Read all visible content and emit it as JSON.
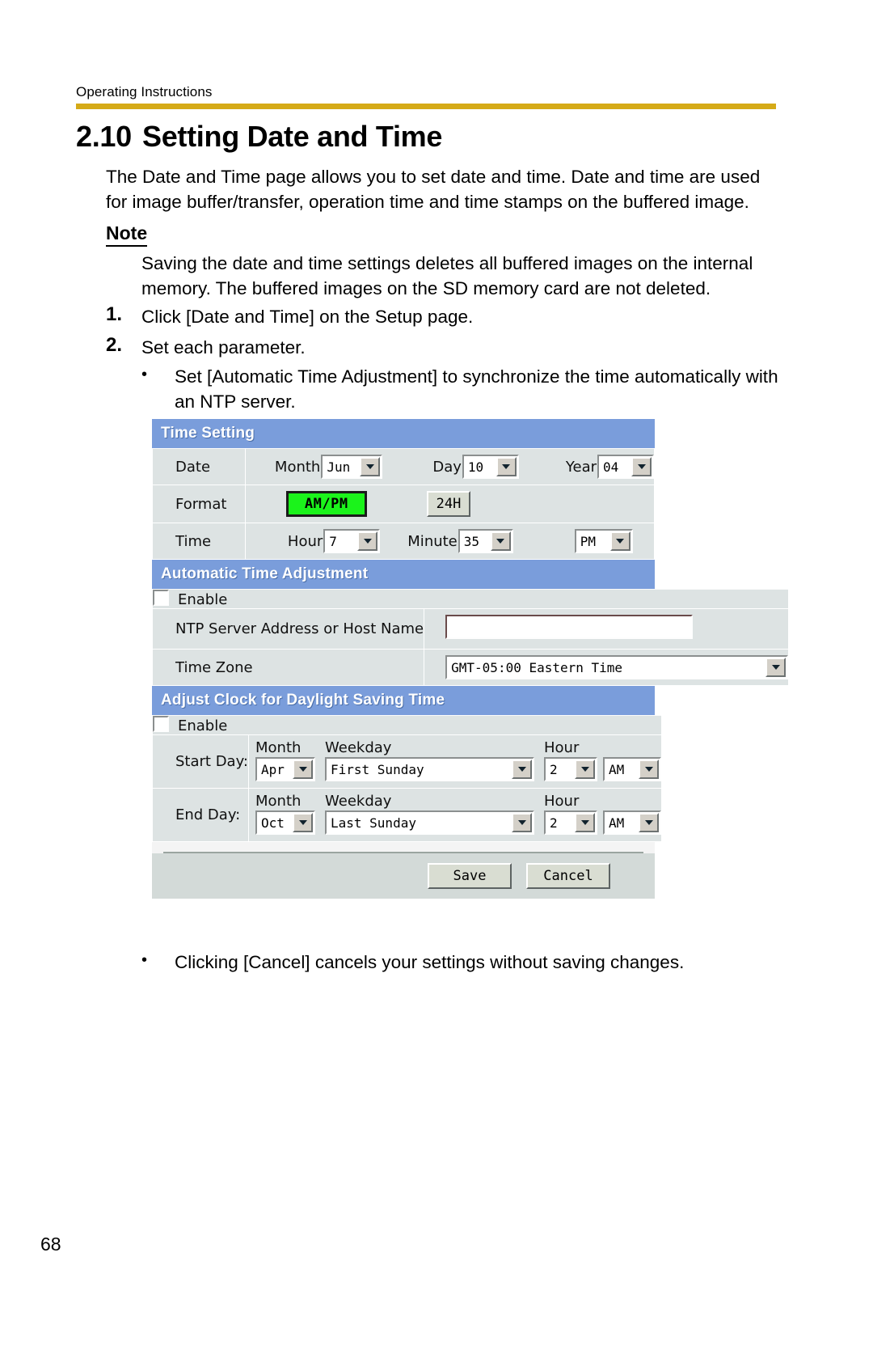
{
  "document": {
    "running_header": "Operating Instructions",
    "section_number": "2.10",
    "section_title": "Setting Date and Time",
    "intro": "The Date and Time page allows you to set date and time. Date and time are used for image buffer/transfer, operation time and time stamps on the buffered image.",
    "note_heading": "Note",
    "note_body": "Saving the date and time settings deletes all buffered images on the internal memory. The buffered images on the SD memory card are not deleted.",
    "steps": [
      {
        "number": "1.",
        "text": "Click [Date and Time] on the Setup page."
      },
      {
        "number": "2.",
        "text": "Set each parameter."
      }
    ],
    "bullets": [
      {
        "marker": "•",
        "text": "Set [Automatic Time Adjustment] to synchronize the time automatically with an NTP server."
      },
      {
        "marker": "•",
        "text": "Clicking [Cancel] cancels your settings without saving changes."
      }
    ],
    "page_number": "68",
    "rule_color": "#d5aa17"
  },
  "screenshot": {
    "band_color": "#7a9ddb",
    "time_setting": {
      "band_title": "Time Setting",
      "date": {
        "label": "Date",
        "month_label": "Month",
        "month_value": "Jun",
        "day_label": "Day",
        "day_value": "10",
        "year_label": "Year",
        "year_value": "04"
      },
      "format": {
        "label": "Format",
        "ampm_button": "AM/PM",
        "ampm_selected": true,
        "h24_button": "24H",
        "selected_color": "#1bf31b"
      },
      "time": {
        "label": "Time",
        "hour_label": "Hour",
        "hour_value": "7",
        "minute_label": "Minute",
        "minute_value": "35",
        "meridiem_value": "PM"
      }
    },
    "automatic_time_adjustment": {
      "band_title": "Automatic Time Adjustment",
      "enable_label": "Enable",
      "enable_checked": false,
      "ntp_label": "NTP Server Address or Host Name",
      "ntp_value": "",
      "timezone_label": "Time Zone",
      "timezone_value": "GMT-05:00 Eastern Time"
    },
    "daylight_saving": {
      "band_title": "Adjust Clock for Daylight Saving Time",
      "enable_label": "Enable",
      "enable_checked": false,
      "column_headers": {
        "month": "Month",
        "weekday": "Weekday",
        "hour": "Hour"
      },
      "start_day": {
        "label": "Start Day:",
        "month": "Apr",
        "weekday": "First Sunday",
        "hour": "2",
        "meridiem": "AM"
      },
      "end_day": {
        "label": "End Day:",
        "month": "Oct",
        "weekday": "Last Sunday",
        "hour": "2",
        "meridiem": "AM"
      }
    },
    "actions": {
      "save": "Save",
      "cancel": "Cancel"
    }
  }
}
